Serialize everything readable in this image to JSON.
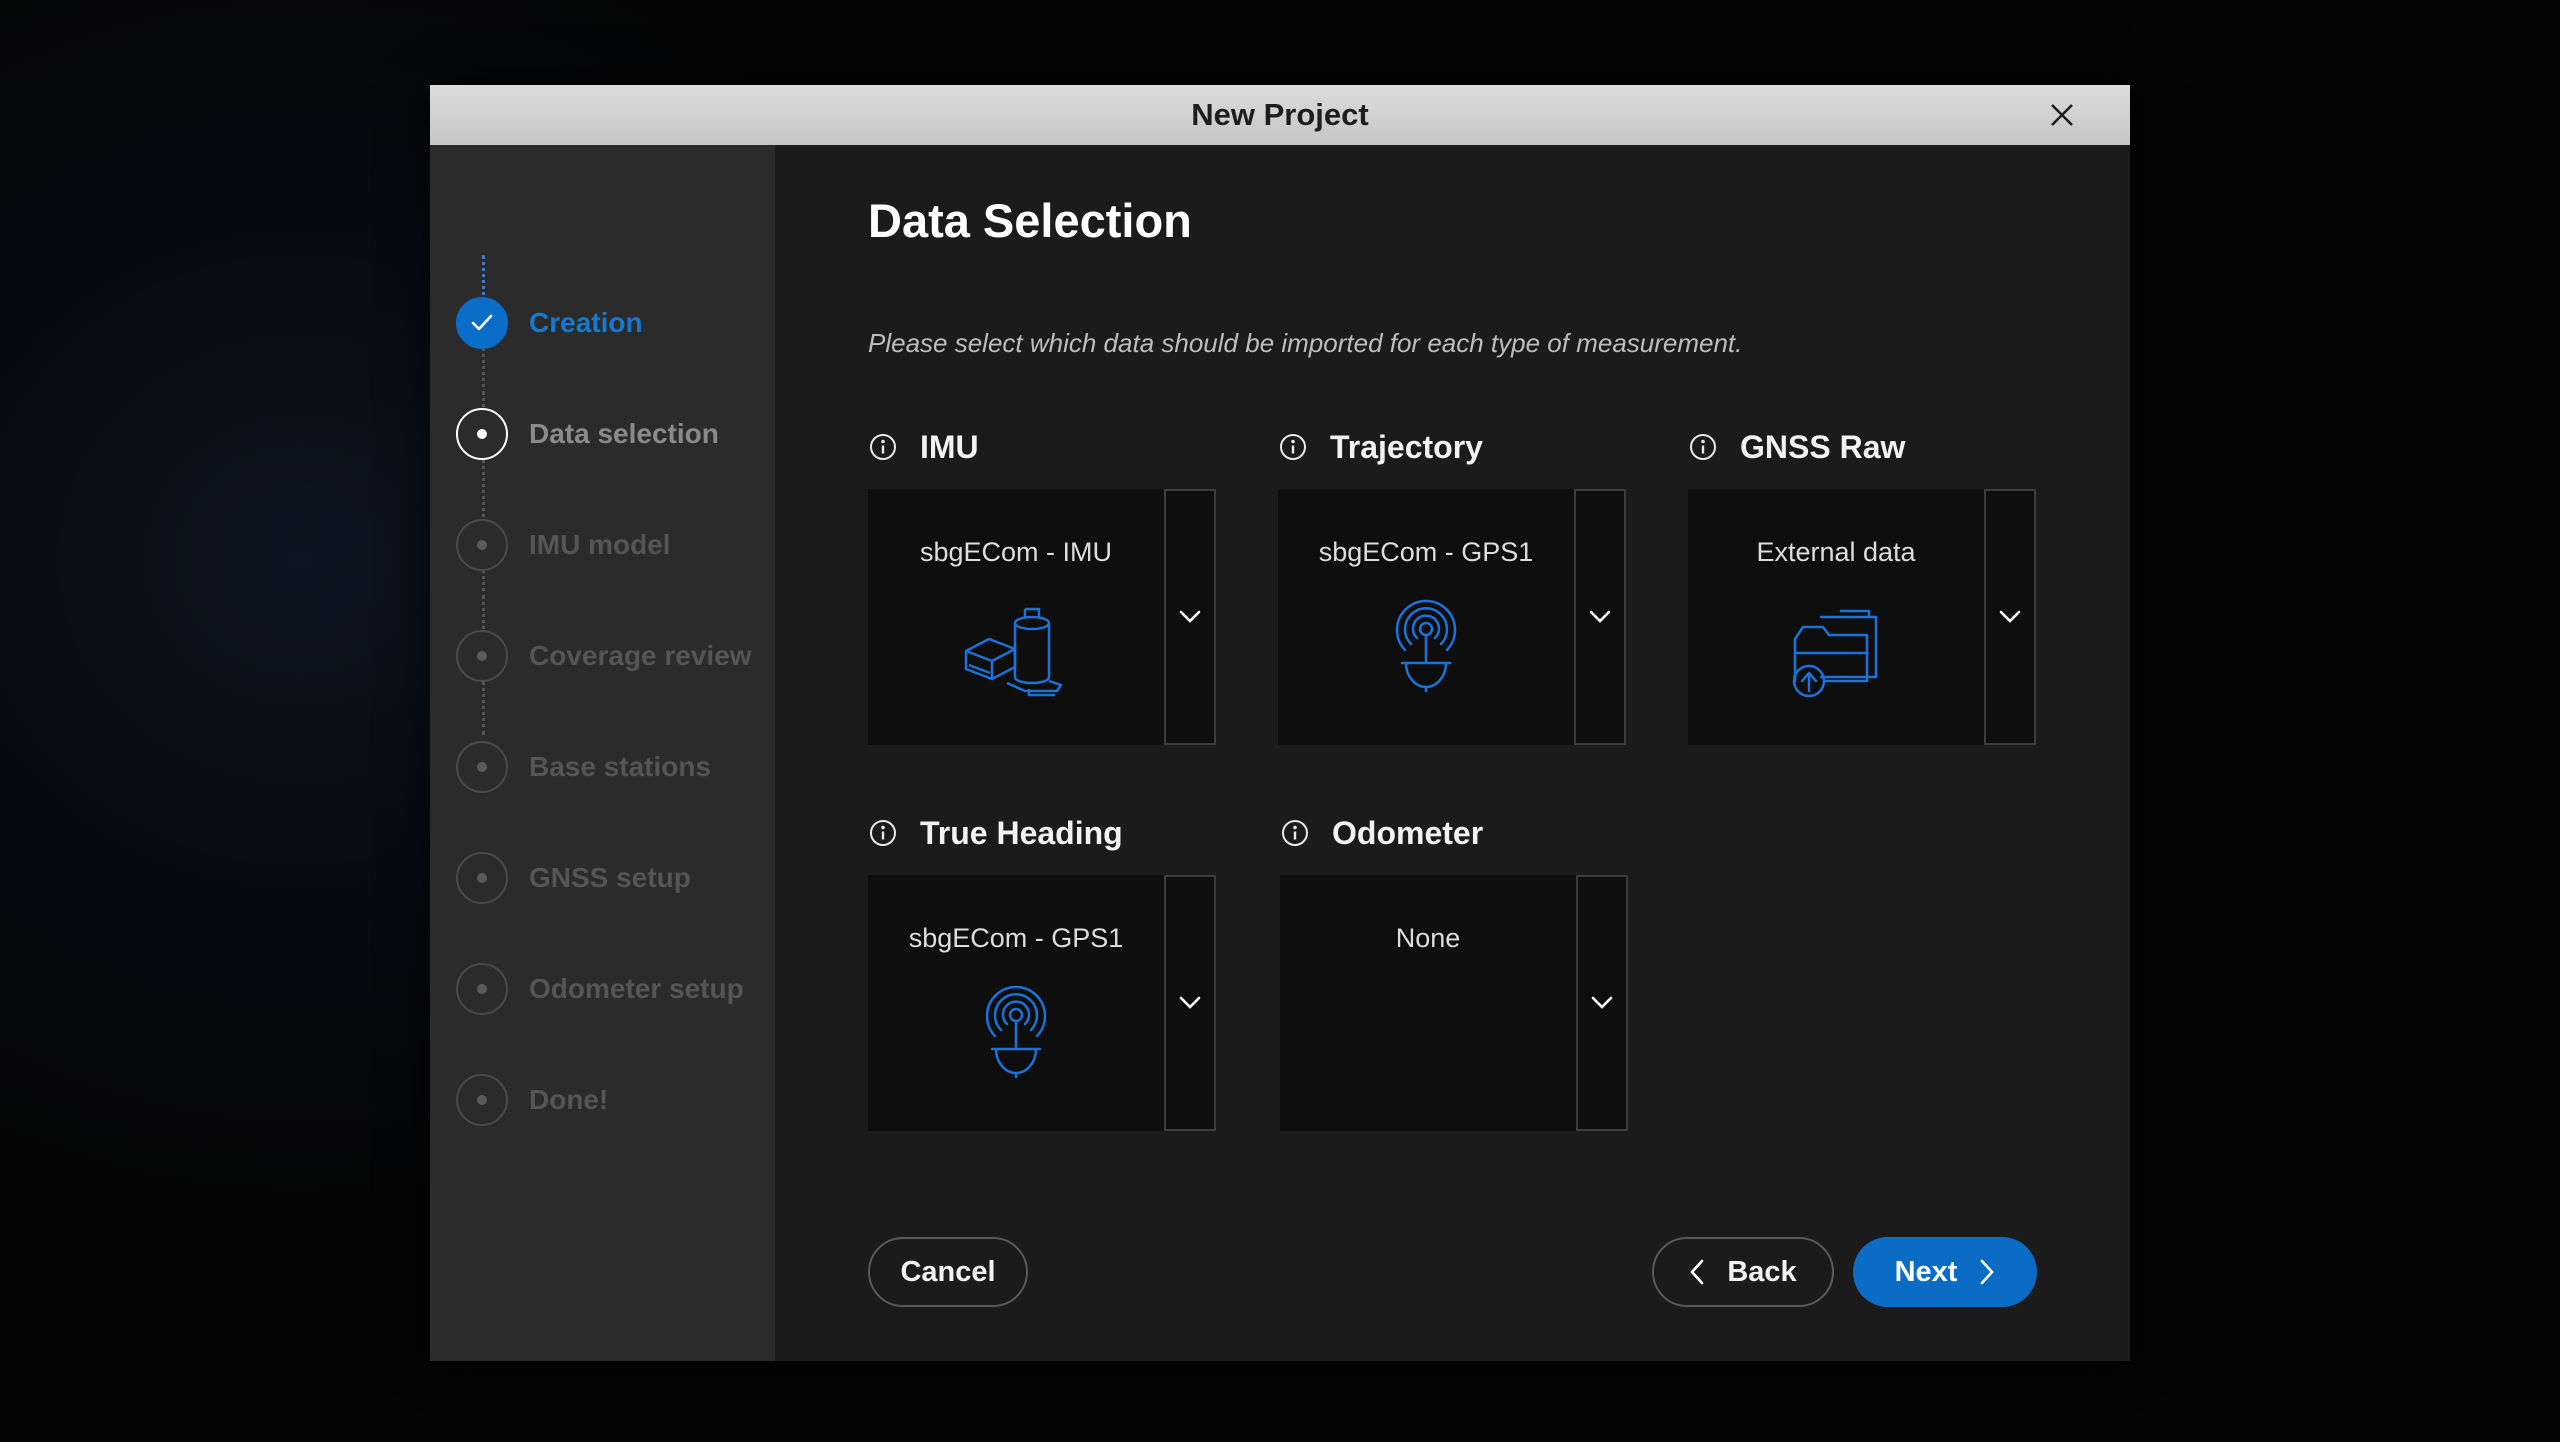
{
  "dialog": {
    "title": "New Project"
  },
  "steps": [
    {
      "label": "Creation",
      "state": "complete"
    },
    {
      "label": "Data selection",
      "state": "current"
    },
    {
      "label": "IMU model",
      "state": "pending"
    },
    {
      "label": "Coverage review",
      "state": "pending"
    },
    {
      "label": "Base stations",
      "state": "pending"
    },
    {
      "label": "GNSS setup",
      "state": "pending"
    },
    {
      "label": "Odometer setup",
      "state": "pending"
    },
    {
      "label": "Done!",
      "state": "pending"
    }
  ],
  "main": {
    "heading": "Data Selection",
    "subtitle": "Please select which data should be imported for each type of measurement."
  },
  "cards": {
    "imu": {
      "title": "IMU",
      "value": "sbgECom - IMU",
      "icon": "imu-device-icon"
    },
    "trajectory": {
      "title": "Trajectory",
      "value": "sbgECom - GPS1",
      "icon": "gnss-antenna-icon"
    },
    "gnss_raw": {
      "title": "GNSS Raw",
      "value": "External data",
      "icon": "external-folder-icon"
    },
    "true_heading": {
      "title": "True Heading",
      "value": "sbgECom - GPS1",
      "icon": "gnss-antenna-icon"
    },
    "odometer": {
      "title": "Odometer",
      "value": "None",
      "icon": ""
    }
  },
  "buttons": {
    "cancel": "Cancel",
    "back": "Back",
    "next": "Next"
  },
  "colors": {
    "accent": "#0b6cc6",
    "icon_blue": "#1a73d9",
    "sidebar": "#2b2b2b",
    "panel": "#1b1b1b"
  }
}
